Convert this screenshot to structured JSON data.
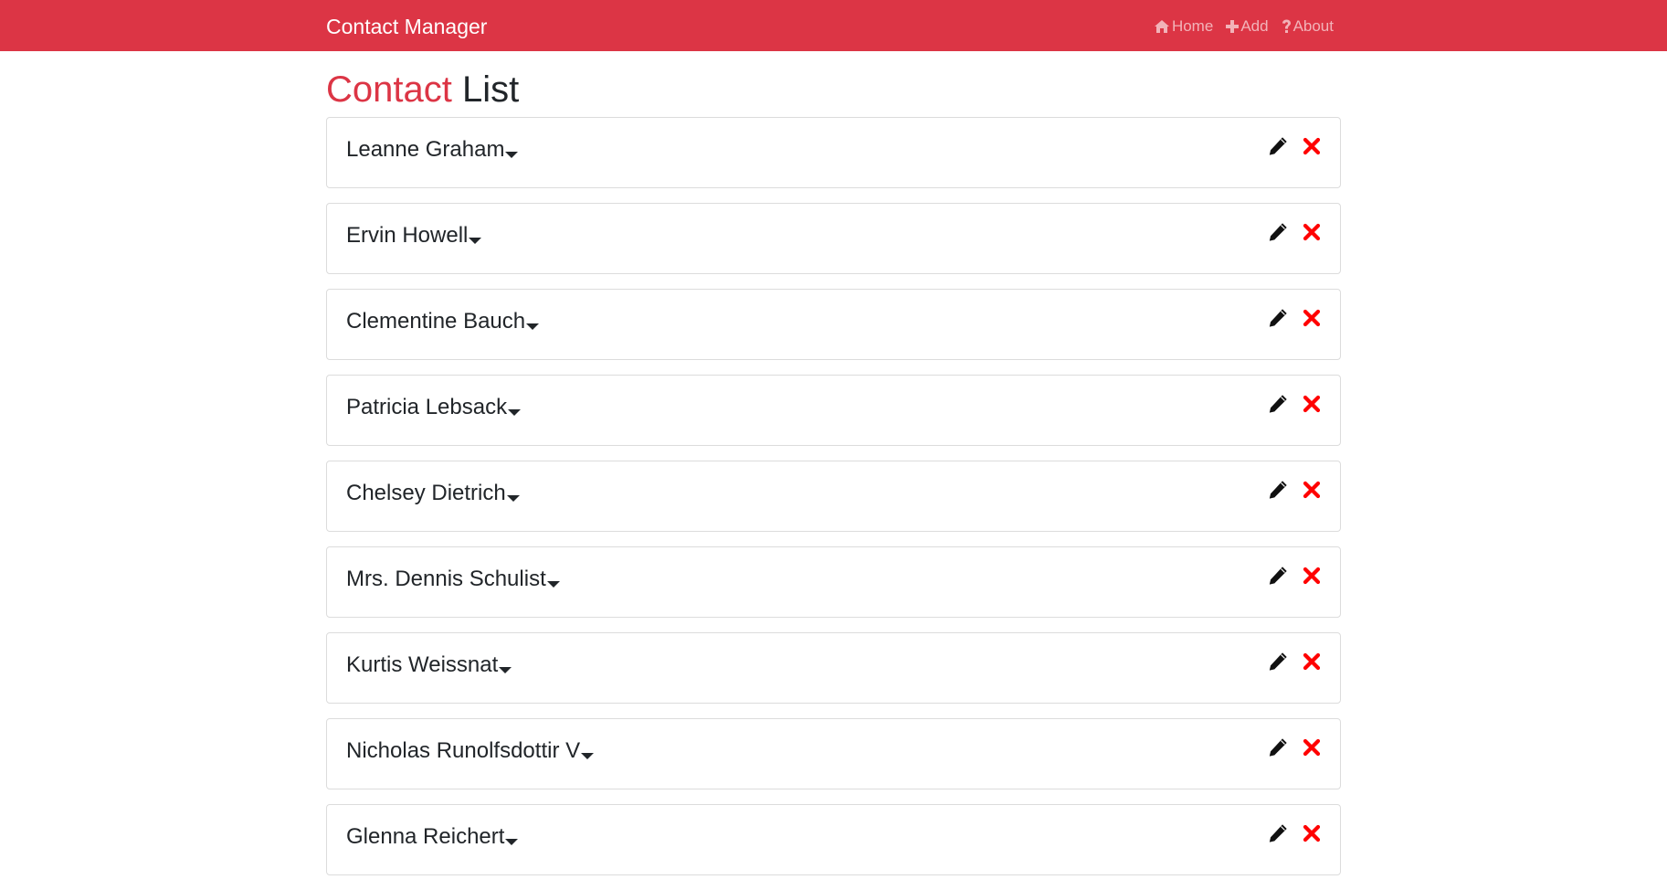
{
  "navbar": {
    "brand": "Contact Manager",
    "links": [
      {
        "label": "Home",
        "icon": "home-icon"
      },
      {
        "label": "Add",
        "icon": "plus-icon"
      },
      {
        "label": "About",
        "icon": "question-icon"
      }
    ]
  },
  "page": {
    "title_accent": "Contact",
    "title_rest": "List"
  },
  "contacts": [
    {
      "name": "Leanne Graham"
    },
    {
      "name": "Ervin Howell"
    },
    {
      "name": "Clementine Bauch"
    },
    {
      "name": "Patricia Lebsack"
    },
    {
      "name": "Chelsey Dietrich"
    },
    {
      "name": "Mrs. Dennis Schulist"
    },
    {
      "name": "Kurtis Weissnat"
    },
    {
      "name": "Nicholas Runolfsdottir V"
    },
    {
      "name": "Glenna Reichert"
    }
  ],
  "icons": {
    "expand": "caret-down-icon",
    "edit": "pencil-icon",
    "delete": "times-icon"
  },
  "colors": {
    "primary": "#dc3545",
    "delete": "#ff0000",
    "text": "#212529"
  }
}
